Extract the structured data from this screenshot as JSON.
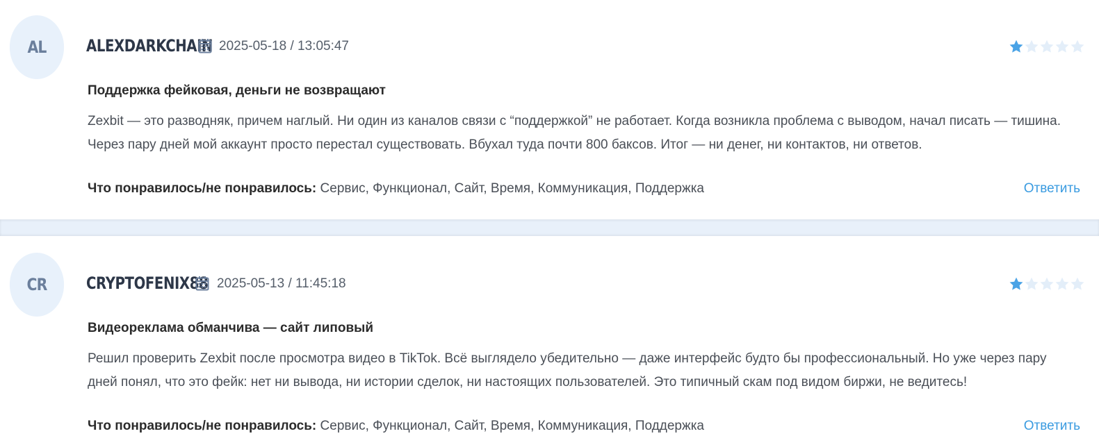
{
  "colors": {
    "accent": "#3a9be0",
    "star_filled": "#4aa3e6",
    "star_empty": "#e3eef9",
    "avatar_bg": "#e8f1fb",
    "divider_bg": "#e8f0fa"
  },
  "reviews": [
    {
      "initials": "AL",
      "username": "ALEXDARKCHAIN",
      "date_icon": "calendar-icon",
      "date": "2025-05-18 / 13:05:47",
      "rating": 1,
      "max_rating": 5,
      "title": "Поддержка фейковая, деньги не возвращают",
      "body": "Zexbit — это разводняк, причем наглый. Ни один из каналов связи с “поддержкой” не работает. Когда возникла проблема с выводом, начал писать — тишина. Через пару дней мой аккаунт просто перестал существовать. Вбухал туда почти 800 баксов. Итог — ни денег, ни контактов, ни ответов.",
      "tags_label": "Что понравилось/не понравилось:",
      "tags_value": "Сервис, Функционал, Сайт, Время, Коммуникация, Поддержка",
      "reply_label": "Ответить"
    },
    {
      "initials": "CR",
      "username": "CRYPTOFENIX88",
      "date_icon": "calendar-icon",
      "date": "2025-05-13 / 11:45:18",
      "rating": 1,
      "max_rating": 5,
      "title": "Видеореклама обманчива — сайт липовый",
      "body": "Решил проверить Zexbit после просмотра видео в TikTok. Всё выглядело убедительно — даже интерфейс будто бы профессиональный. Но уже через пару дней понял, что это фейк: нет ни вывода, ни истории сделок, ни настоящих пользователей. Это типичный скам под видом биржи, не ведитесь!",
      "tags_label": "Что понравилось/не понравилось:",
      "tags_value": "Сервис, Функционал, Сайт, Время, Коммуникация, Поддержка",
      "reply_label": "Ответить"
    }
  ]
}
